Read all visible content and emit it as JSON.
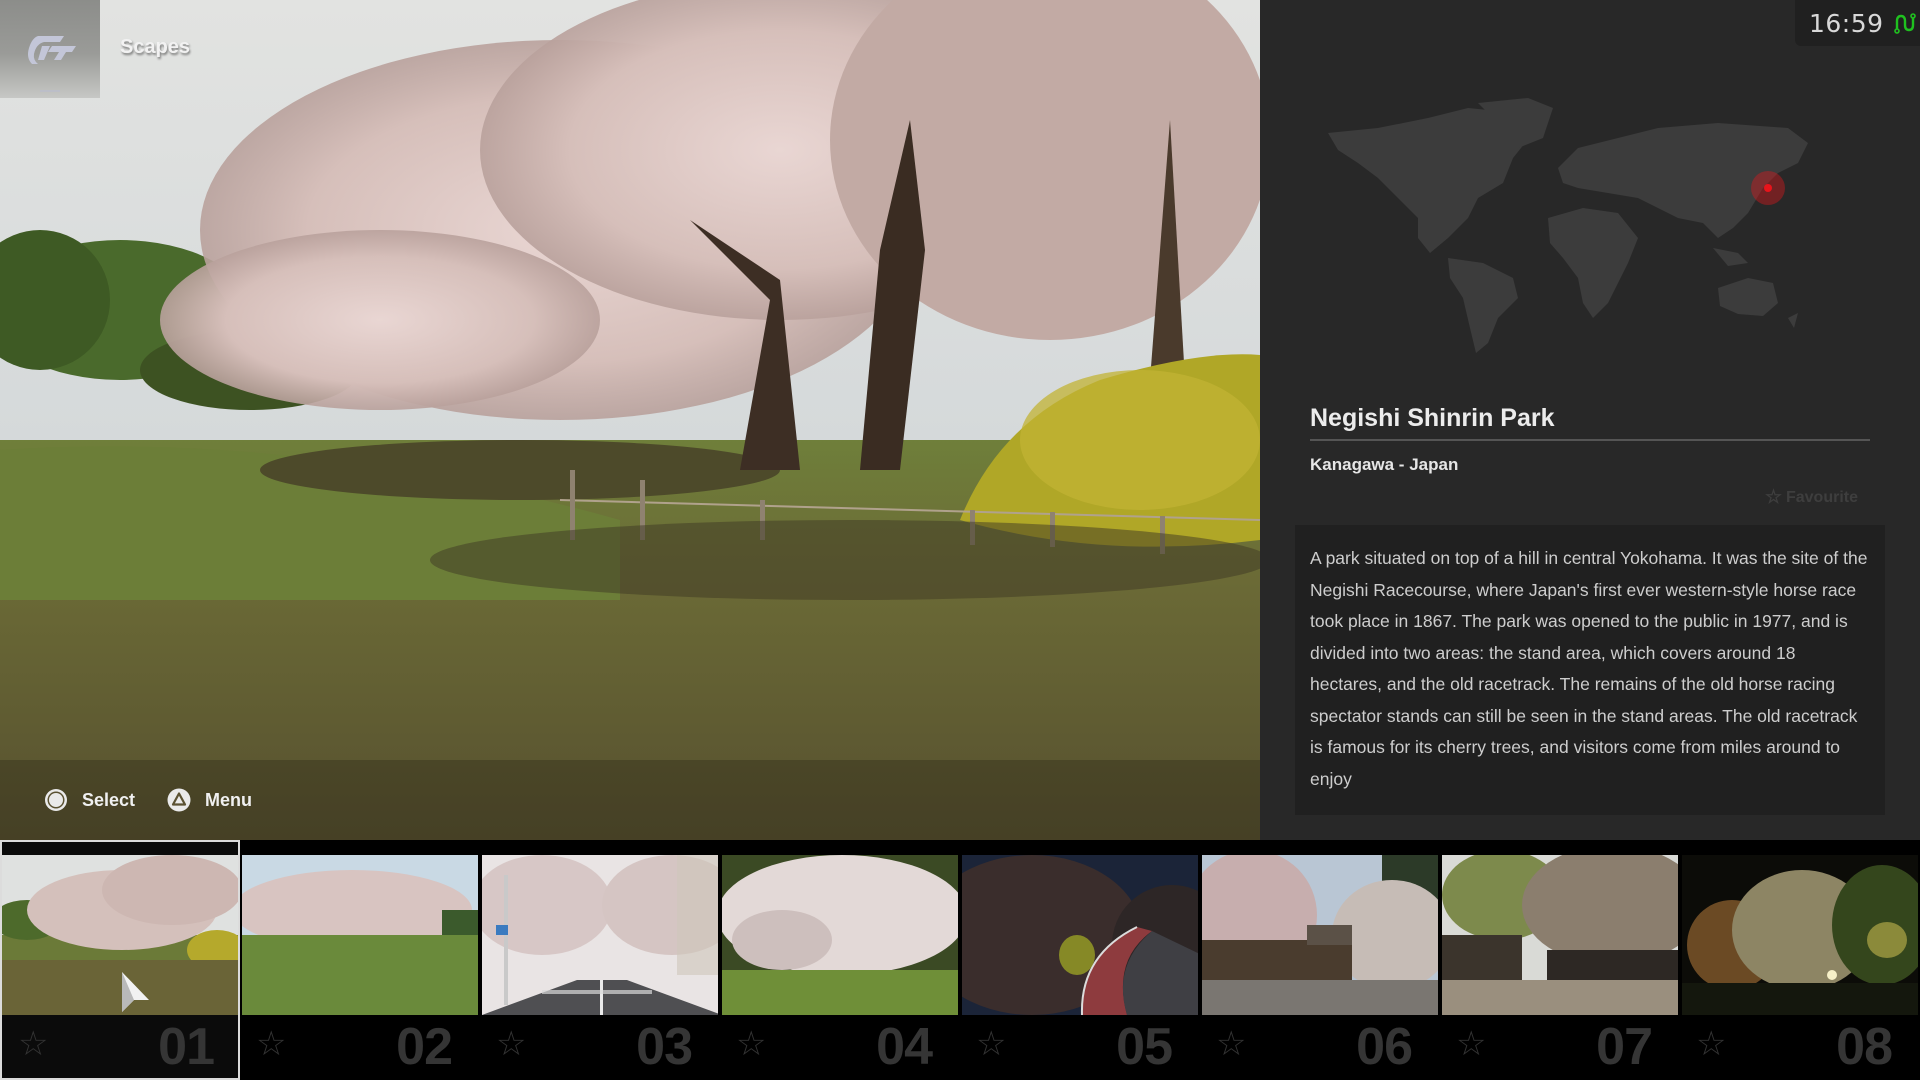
{
  "header": {
    "logo": "gt-logo-icon",
    "app_title": "Scapes"
  },
  "status": {
    "clock": "16:59",
    "connection_icon": "network-connected-icon",
    "connection_color": "#1fc11f"
  },
  "prompts": [
    {
      "icon": "circle-button-icon",
      "label": "Select"
    },
    {
      "icon": "triangle-button-icon",
      "label": "Menu"
    }
  ],
  "location": {
    "map_marker_region": "Japan",
    "marker_color": "#e0161b",
    "title": "Negishi Shinrin Park",
    "subtitle": "Kanagawa - Japan",
    "favourite_label": "Favourite",
    "favourite_icon": "star-outline-icon",
    "is_favourite": false,
    "description": "A park situated on top of a hill in central Yokohama. It was the site of the Negishi Racecourse, where Japan's first ever western-style horse race took place in 1867. The park was opened to the public in 1977, and is divided into two areas: the stand area, which covers around 18 hectares, and the old racetrack. The remains of the old horse racing spectator stands can still be seen in the stand areas. The old racetrack is famous for its cherry trees, and visitors come from miles around to enjoy"
  },
  "thumbnails": [
    {
      "number": "01",
      "scene": "cherry trees on grassy hill with yellow flowers",
      "favourite": false,
      "selected": true
    },
    {
      "number": "02",
      "scene": "row of cherry trees on open lawn",
      "favourite": false,
      "selected": false
    },
    {
      "number": "03",
      "scene": "city street lined with cherry trees",
      "favourite": false,
      "selected": false
    },
    {
      "number": "04",
      "scene": "large white cherry tree on lawn",
      "favourite": false,
      "selected": false
    },
    {
      "number": "05",
      "scene": "night road with illuminated cherry trees",
      "favourite": false,
      "selected": false
    },
    {
      "number": "06",
      "scene": "weeping cherry trees by traditional building",
      "favourite": false,
      "selected": false
    },
    {
      "number": "07",
      "scene": "black wooden fences with cherry trees",
      "favourite": false,
      "selected": false
    },
    {
      "number": "08",
      "scene": "illuminated weeping cherry at night",
      "favourite": false,
      "selected": false
    }
  ]
}
